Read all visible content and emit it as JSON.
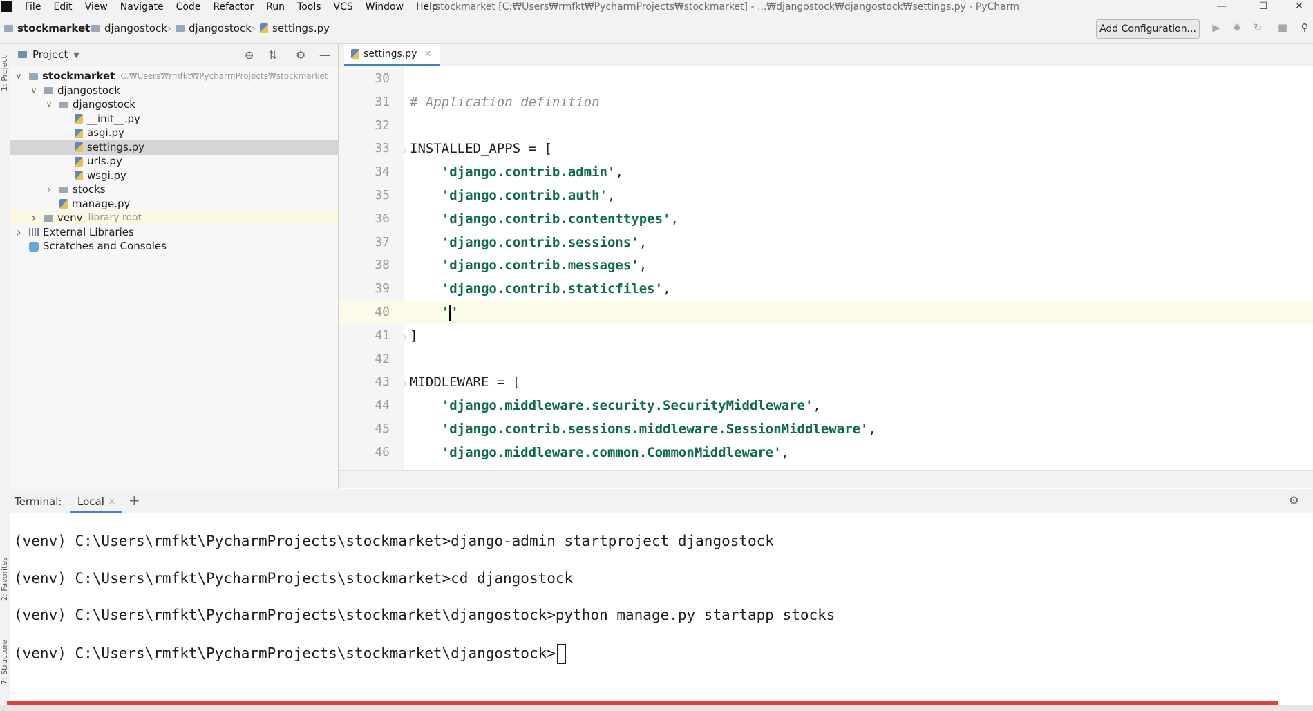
{
  "menu": {
    "items": [
      "File",
      "Edit",
      "View",
      "Navigate",
      "Code",
      "Refactor",
      "Run",
      "Tools",
      "VCS",
      "Window",
      "Help"
    ],
    "window_title": "stockmarket [C:₩Users₩rmfkt₩PycharmProjects₩stockmarket] - ...₩djangostock₩djangostock₩settings.py - PyCharm"
  },
  "breadcrumb": [
    "stockmarket",
    "djangostock",
    "djangostock",
    "settings.py"
  ],
  "toolbar": {
    "add_configuration": "Add Configuration..."
  },
  "side_tabs": {
    "project": "1: Project",
    "favorites": "2: Favorites",
    "structure": "7: Structure"
  },
  "project": {
    "title": "Project",
    "tree": [
      {
        "label": "stockmarket",
        "hint": "C:₩Users₩rmfkt₩PycharmProjects₩stockmarket",
        "type": "folder",
        "indent": 0,
        "arrow": "open",
        "bold": true
      },
      {
        "label": "djangostock",
        "type": "folder",
        "indent": 1,
        "arrow": "open"
      },
      {
        "label": "djangostock",
        "type": "folder",
        "indent": 2,
        "arrow": "open"
      },
      {
        "label": "__init__.py",
        "type": "py",
        "indent": 3
      },
      {
        "label": "asgi.py",
        "type": "py",
        "indent": 3
      },
      {
        "label": "settings.py",
        "type": "py",
        "indent": 3,
        "selected": true
      },
      {
        "label": "urls.py",
        "type": "py",
        "indent": 3
      },
      {
        "label": "wsgi.py",
        "type": "py",
        "indent": 3
      },
      {
        "label": "stocks",
        "type": "folder",
        "indent": 2,
        "arrow": "closed"
      },
      {
        "label": "manage.py",
        "type": "py",
        "indent": 2
      },
      {
        "label": "venv",
        "hint": "library root",
        "type": "folder",
        "indent": 1,
        "arrow": "closed",
        "venv": true
      },
      {
        "label": "External Libraries",
        "type": "lib",
        "indent": 0,
        "arrow": "closed"
      },
      {
        "label": "Scratches and Consoles",
        "type": "scratch",
        "indent": 0
      }
    ]
  },
  "editor": {
    "tab": "settings.py",
    "lines": [
      {
        "n": "30",
        "parts": []
      },
      {
        "n": "31",
        "parts": [
          [
            "cmt",
            "# Application definition"
          ]
        ]
      },
      {
        "n": "32",
        "parts": []
      },
      {
        "n": "33",
        "parts": [
          [
            "plain",
            "INSTALLED_APPS = ["
          ]
        ],
        "fold": true
      },
      {
        "n": "34",
        "parts": [
          [
            "plain",
            "    "
          ],
          [
            "str",
            "'django.contrib.admin'"
          ],
          [
            "plain",
            ","
          ]
        ]
      },
      {
        "n": "35",
        "parts": [
          [
            "plain",
            "    "
          ],
          [
            "str",
            "'django.contrib.auth'"
          ],
          [
            "plain",
            ","
          ]
        ]
      },
      {
        "n": "36",
        "parts": [
          [
            "plain",
            "    "
          ],
          [
            "str",
            "'django.contrib.contenttypes'"
          ],
          [
            "plain",
            ","
          ]
        ]
      },
      {
        "n": "37",
        "parts": [
          [
            "plain",
            "    "
          ],
          [
            "str",
            "'django.contrib.sessions'"
          ],
          [
            "plain",
            ","
          ]
        ]
      },
      {
        "n": "38",
        "parts": [
          [
            "plain",
            "    "
          ],
          [
            "str",
            "'django.contrib.messages'"
          ],
          [
            "plain",
            ","
          ]
        ]
      },
      {
        "n": "39",
        "parts": [
          [
            "plain",
            "    "
          ],
          [
            "str",
            "'django.contrib.staticfiles'"
          ],
          [
            "plain",
            ","
          ]
        ]
      },
      {
        "n": "40",
        "parts": [
          [
            "plain",
            "    "
          ],
          [
            "str",
            "'"
          ],
          [
            "cursor",
            ""
          ],
          [
            "str",
            "'"
          ]
        ],
        "current": true
      },
      {
        "n": "41",
        "parts": [
          [
            "plain",
            "]"
          ]
        ],
        "fold": true
      },
      {
        "n": "42",
        "parts": []
      },
      {
        "n": "43",
        "parts": [
          [
            "plain",
            "MIDDLEWARE = ["
          ]
        ],
        "fold": true
      },
      {
        "n": "44",
        "parts": [
          [
            "plain",
            "    "
          ],
          [
            "str",
            "'django.middleware.security.SecurityMiddleware'"
          ],
          [
            "plain",
            ","
          ]
        ]
      },
      {
        "n": "45",
        "parts": [
          [
            "plain",
            "    "
          ],
          [
            "str",
            "'django.contrib.sessions.middleware.SessionMiddleware'"
          ],
          [
            "plain",
            ","
          ]
        ]
      },
      {
        "n": "46",
        "parts": [
          [
            "plain",
            "    "
          ],
          [
            "str",
            "'django.middleware.common.CommonMiddleware'"
          ],
          [
            "plain",
            ","
          ]
        ]
      }
    ]
  },
  "terminal": {
    "label": "Terminal:",
    "tab": "Local",
    "lines": [
      "(venv) C:\\Users\\rmfkt\\PycharmProjects\\stockmarket>django-admin startproject djangostock",
      "(venv) C:\\Users\\rmfkt\\PycharmProjects\\stockmarket>cd djangostock",
      "(venv) C:\\Users\\rmfkt\\PycharmProjects\\stockmarket\\djangostock>python manage.py startapp stocks",
      "(venv) C:\\Users\\rmfkt\\PycharmProjects\\stockmarket\\djangostock>"
    ]
  },
  "colors": {
    "accent": "#4083c9",
    "string": "#0b6b4a",
    "comment": "#8c8c8c",
    "progress": "#e83b3b"
  }
}
